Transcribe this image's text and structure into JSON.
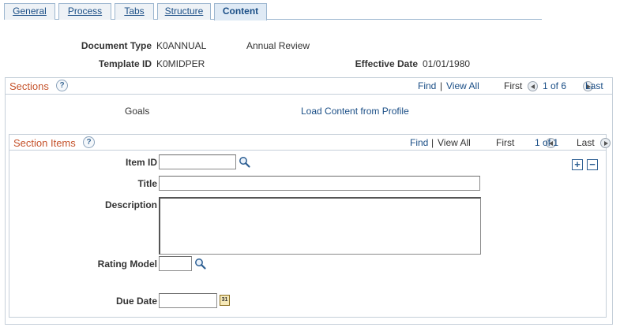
{
  "tabs": [
    {
      "label": "General"
    },
    {
      "label": "Process"
    },
    {
      "label": "Tabs"
    },
    {
      "label": "Structure"
    },
    {
      "label": "Content"
    }
  ],
  "header": {
    "document_type_label": "Document Type",
    "document_type_value": "K0ANNUAL",
    "document_type_desc": "Annual Review",
    "template_id_label": "Template ID",
    "template_id_value": "K0MIDPER",
    "effective_date_label": "Effective Date",
    "effective_date_value": "01/01/1980"
  },
  "sections": {
    "title": "Sections",
    "help": "?",
    "find": "Find",
    "separator": "|",
    "view_all": "View All",
    "first": "First",
    "count": "1 of 6",
    "last": "Last",
    "section_name": "Goals",
    "load_link": "Load Content from Profile"
  },
  "section_items": {
    "title": "Section Items",
    "help": "?",
    "find": "Find",
    "separator": "|",
    "view_all": "View All",
    "first": "First",
    "count": "1 of 1",
    "last": "Last",
    "add": "+",
    "remove": "−",
    "item_id_label": "Item ID",
    "item_id_value": "",
    "title_label": "Title",
    "title_value": "",
    "description_label": "Description",
    "description_value": "",
    "rating_model_label": "Rating Model",
    "rating_model_value": "",
    "due_date_label": "Due Date",
    "due_date_value": "",
    "calendar_day": "31"
  },
  "icons": [
    "search-icon",
    "calendar-icon",
    "help-icon",
    "prev-arrow-icon",
    "next-arrow-icon"
  ]
}
